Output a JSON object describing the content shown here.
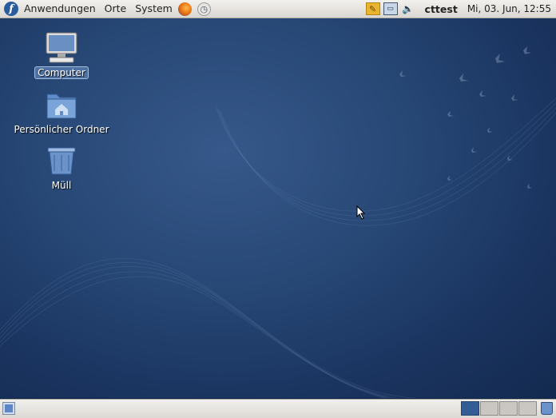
{
  "top_panel": {
    "menus": [
      "Anwendungen",
      "Orte",
      "System"
    ],
    "logo_glyph": "f",
    "user": "cttest",
    "clock": "Mi, 03. Jun, 12:55",
    "tray_icons": [
      "update-icon",
      "network-icon",
      "volume-icon"
    ]
  },
  "desktop": {
    "icons": [
      {
        "label": "Computer",
        "icon": "computer-icon",
        "selected": true
      },
      {
        "label": "Persönlicher Ordner",
        "icon": "home-folder-icon",
        "selected": false
      },
      {
        "label": "Müll",
        "icon": "trash-icon",
        "selected": false
      }
    ]
  },
  "bottom_panel": {
    "workspaces": 4,
    "active_workspace": 1
  },
  "colors": {
    "panel_bg": "#e6e3df",
    "desktop_bg": "#1d3a66",
    "active_workspace": "#335d94"
  }
}
